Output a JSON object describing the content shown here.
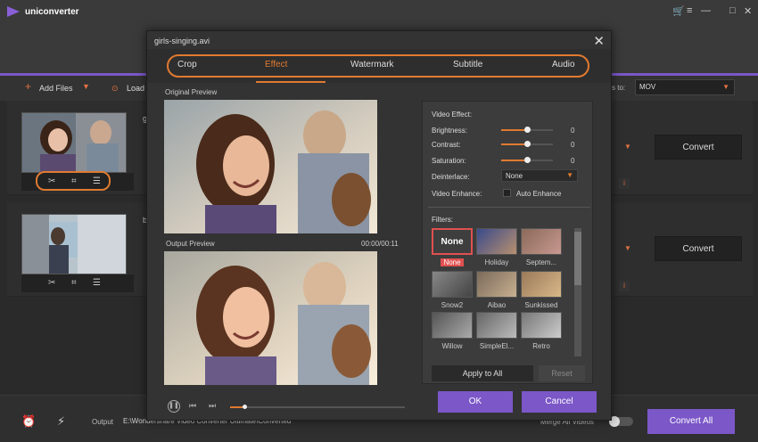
{
  "app": {
    "name": "uniconverter"
  },
  "window_controls": [
    "🛒",
    "≡",
    "—",
    "□",
    "✕"
  ],
  "colors": {
    "accent": "#7b57c8",
    "highlight": "#e07a30",
    "selected_filter": "#e05050"
  },
  "toolbar": {
    "add_files": "Add Files",
    "load": "Load",
    "convert_to_label": "s to:",
    "format": "MOV"
  },
  "files": [
    {
      "name_fragment": "g",
      "convert_label": "Convert",
      "thumb_icons": [
        "scissors-icon",
        "crop-icon",
        "settings-sliders-icon"
      ]
    },
    {
      "name_fragment": "b",
      "convert_label": "Convert",
      "thumb_icons": [
        "scissors-icon",
        "crop-icon",
        "settings-sliders-icon"
      ]
    }
  ],
  "bottom": {
    "output_label": "Output",
    "output_path": "E:\\Wondershare Video Converter Ultimate\\Converted",
    "merge_label": "Merge All Videos",
    "convert_all": "Convert All"
  },
  "dialog": {
    "title": "girls-singing.avi",
    "tabs": [
      "Crop",
      "Effect",
      "Watermark",
      "Subtitle",
      "Audio"
    ],
    "active_tab": "Effect",
    "original_preview_label": "Original Preview",
    "output_preview_label": "Output Preview",
    "time": "00:00/00:11",
    "playback_progress": 0.08,
    "video_effect_label": "Video Effect:",
    "brightness_label": "Brightness:",
    "brightness_value": "0",
    "contrast_label": "Contrast:",
    "contrast_value": "0",
    "saturation_label": "Saturation:",
    "saturation_value": "0",
    "slider_position": 0.5,
    "deinterlace_label": "Deinterlace:",
    "deinterlace_value": "None",
    "enhance_label": "Video Enhance:",
    "auto_enhance_label": "Auto Enhance",
    "filters_label": "Filters:",
    "filters": [
      {
        "name": "None",
        "thumb_text": "None",
        "selected": true
      },
      {
        "name": "Holiday",
        "selected": false
      },
      {
        "name": "Septem...",
        "selected": false
      },
      {
        "name": "Snow2",
        "selected": false
      },
      {
        "name": "Aibao",
        "selected": false
      },
      {
        "name": "Sunkissed",
        "selected": false
      },
      {
        "name": "Willow",
        "selected": false
      },
      {
        "name": "SimpleEl...",
        "selected": false
      },
      {
        "name": "Retro",
        "selected": false
      }
    ],
    "apply_all_label": "Apply to All",
    "reset_label": "Reset",
    "ok_label": "OK",
    "cancel_label": "Cancel"
  }
}
